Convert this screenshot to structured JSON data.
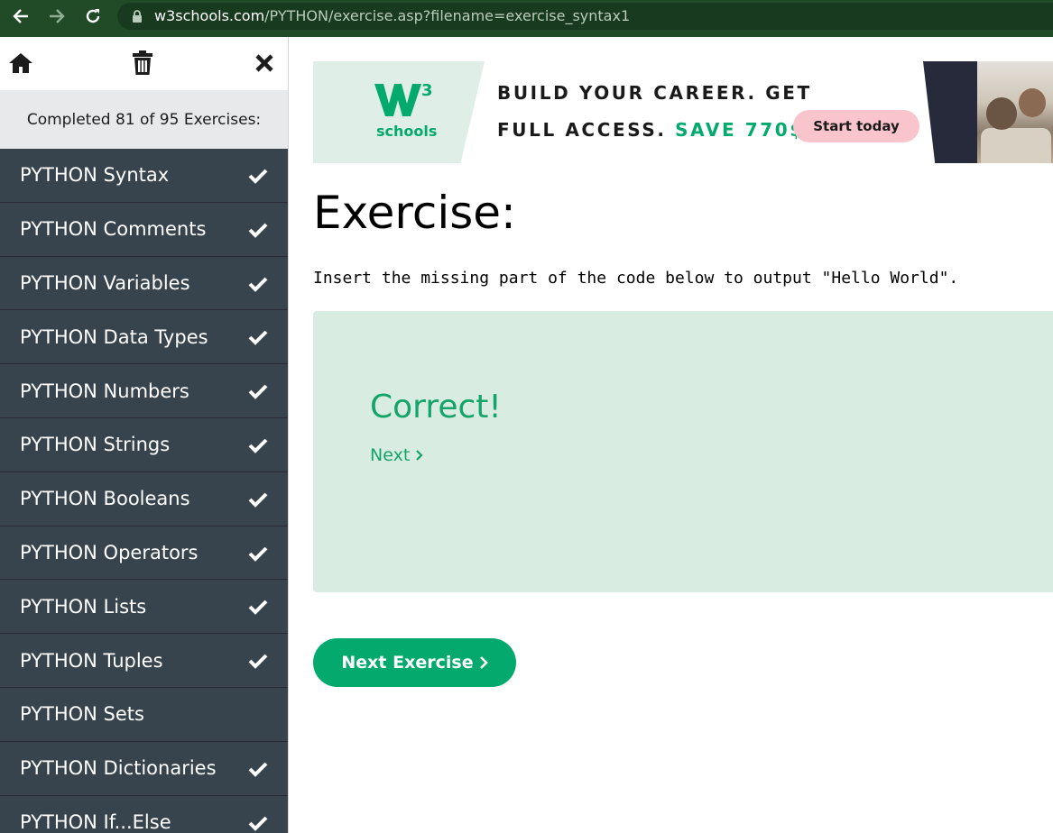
{
  "browser": {
    "url_host": "w3schools.com",
    "url_path": "/PYTHON/exercise.asp?filename=exercise_syntax1",
    "icons": [
      "back-arrow-icon",
      "forward-arrow-icon",
      "reload-icon",
      "lock-icon"
    ]
  },
  "sidebar": {
    "tools": [
      "home-icon",
      "trash-icon",
      "close-icon"
    ],
    "progress_text": "Completed 81 of 95 Exercises:",
    "topics": [
      {
        "label": "PYTHON Syntax",
        "completed": true
      },
      {
        "label": "PYTHON Comments",
        "completed": true
      },
      {
        "label": "PYTHON Variables",
        "completed": true
      },
      {
        "label": "PYTHON Data Types",
        "completed": true
      },
      {
        "label": "PYTHON Numbers",
        "completed": true
      },
      {
        "label": "PYTHON Strings",
        "completed": true
      },
      {
        "label": "PYTHON Booleans",
        "completed": true
      },
      {
        "label": "PYTHON Operators",
        "completed": true
      },
      {
        "label": "PYTHON Lists",
        "completed": true
      },
      {
        "label": "PYTHON Tuples",
        "completed": true
      },
      {
        "label": "PYTHON Sets",
        "completed": false
      },
      {
        "label": "PYTHON Dictionaries",
        "completed": true
      },
      {
        "label": "PYTHON If...Else",
        "completed": true
      }
    ]
  },
  "ad": {
    "logo_sup": "3",
    "logo_text": "schools",
    "line1": "BUILD YOUR CAREER. GET",
    "line2_prefix": "FULL ACCESS.",
    "line2_highlight": "SAVE 770$",
    "cta": "Start today"
  },
  "main": {
    "heading": "Exercise:",
    "instruction": "Insert the missing part of the code below to output \"Hello World\".",
    "result": "Correct!",
    "next_link": "Next",
    "next_exercise_button": "Next Exercise"
  },
  "colors": {
    "accent": "#04aa6d",
    "sidebar_bg": "#38444d",
    "result_bg": "#d9ece1",
    "chrome_bg": "#214b27"
  }
}
